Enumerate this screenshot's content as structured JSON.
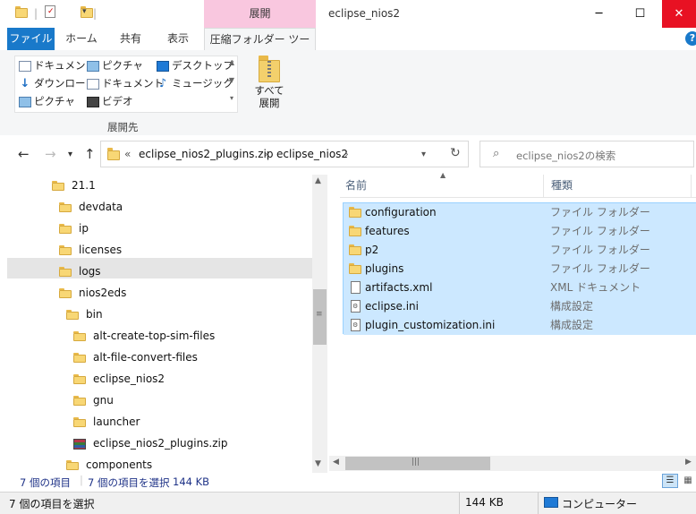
{
  "window": {
    "title": "eclipse_nios2",
    "context_tab_header": "展開",
    "controls": {
      "minimize": "─",
      "maximize": "☐",
      "close": "✕"
    }
  },
  "ribbon_tabs": [
    "ファイル",
    "ホーム",
    "共有",
    "表示",
    "圧縮フォルダー ツール"
  ],
  "ribbon": {
    "gallery_items": [
      {
        "label": "ドキュメント",
        "icon": "documents-icon"
      },
      {
        "label": "ピクチャ",
        "icon": "pictures-icon"
      },
      {
        "label": "デスクトップ",
        "icon": "desktop-icon"
      },
      {
        "label": "ダウンロード",
        "icon": "downloads-icon"
      },
      {
        "label": "ドキュメント",
        "icon": "documents-icon"
      },
      {
        "label": "ミュージック",
        "icon": "music-icon"
      },
      {
        "label": "ピクチャ",
        "icon": "pictures-icon"
      },
      {
        "label": "ビデオ",
        "icon": "videos-icon"
      }
    ],
    "group_label": "展開先",
    "extract_all_label_line1": "すべて",
    "extract_all_label_line2": "展開"
  },
  "address": {
    "prefix": "«",
    "crumbs": [
      "eclipse_nios2_plugins.zip",
      "eclipse_nios2"
    ],
    "separator": "›",
    "search_placeholder": "eclipse_nios2の検索"
  },
  "tree": [
    {
      "label": "21.1",
      "indent": 0,
      "kind": "folder"
    },
    {
      "label": "devdata",
      "indent": 1,
      "kind": "folder"
    },
    {
      "label": "ip",
      "indent": 1,
      "kind": "folder"
    },
    {
      "label": "licenses",
      "indent": 1,
      "kind": "folder"
    },
    {
      "label": "logs",
      "indent": 1,
      "kind": "folder"
    },
    {
      "label": "nios2eds",
      "indent": 1,
      "kind": "folder"
    },
    {
      "label": "bin",
      "indent": 2,
      "kind": "folder"
    },
    {
      "label": "alt-create-top-sim-files",
      "indent": 3,
      "kind": "folder"
    },
    {
      "label": "alt-file-convert-files",
      "indent": 3,
      "kind": "folder"
    },
    {
      "label": "eclipse_nios2",
      "indent": 3,
      "kind": "folder"
    },
    {
      "label": "gnu",
      "indent": 3,
      "kind": "folder"
    },
    {
      "label": "launcher",
      "indent": 3,
      "kind": "folder"
    },
    {
      "label": "eclipse_nios2_plugins.zip",
      "indent": 3,
      "kind": "zip",
      "selected": true
    },
    {
      "label": "components",
      "indent": 2,
      "kind": "folder"
    }
  ],
  "columns": {
    "name": "名前",
    "type": "種類"
  },
  "files": [
    {
      "name": "configuration",
      "type": "ファイル フォルダー",
      "icon": "folder-icon"
    },
    {
      "name": "features",
      "type": "ファイル フォルダー",
      "icon": "folder-icon"
    },
    {
      "name": "p2",
      "type": "ファイル フォルダー",
      "icon": "folder-icon"
    },
    {
      "name": "plugins",
      "type": "ファイル フォルダー",
      "icon": "folder-icon"
    },
    {
      "name": "artifacts.xml",
      "type": "XML ドキュメント",
      "icon": "document-icon"
    },
    {
      "name": "eclipse.ini",
      "type": "構成設定",
      "icon": "settings-file-icon"
    },
    {
      "name": "plugin_customization.ini",
      "type": "構成設定",
      "icon": "settings-file-icon"
    }
  ],
  "status": {
    "item_count": "7 個の項目",
    "selected_count": "7 個の項目を選択",
    "selected_size": "144 KB",
    "bottom_selected": "7 個の項目を選択",
    "bottom_size": "144 KB",
    "bottom_location": "コンピューター"
  }
}
